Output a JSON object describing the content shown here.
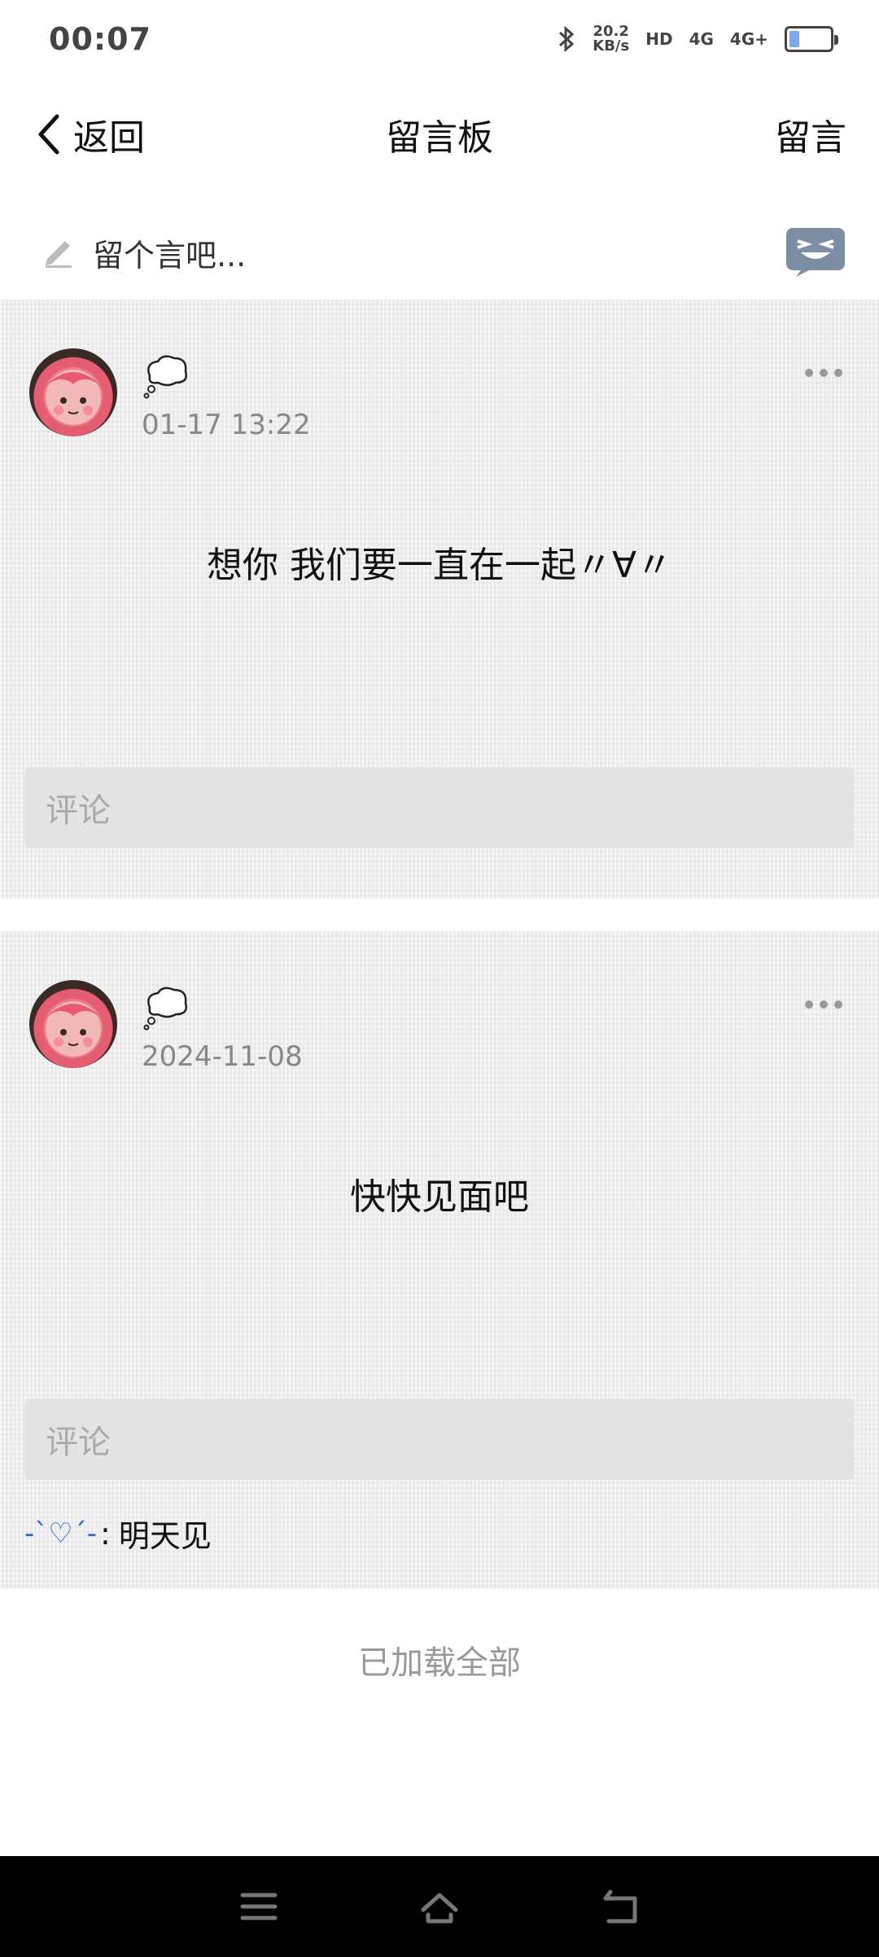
{
  "status": {
    "time": "00:07",
    "net_speed_value": "20.2",
    "net_speed_unit": "KB/s",
    "hd_tag": "HD",
    "sim1": "4G",
    "sim2": "4G+",
    "battery_level": 0.25,
    "icons": [
      "bluetooth-icon",
      "hd-icon",
      "signal-icon",
      "battery-icon"
    ]
  },
  "nav": {
    "back_label": "返回",
    "title": "留言板",
    "action_label": "留言"
  },
  "compose": {
    "placeholder": "留个言吧..."
  },
  "posts": [
    {
      "time": "01-17 13:22",
      "message": "想你 我们要一直在一起〃∀〃",
      "comment_placeholder": "评论"
    },
    {
      "time": "2024-11-08",
      "message": "快快见面吧",
      "comment_placeholder": "评论",
      "reply": {
        "name": "-ˋ♡ˊ-",
        "text": "明天见"
      }
    }
  ],
  "footer": {
    "loaded_text": "已加载全部"
  },
  "colors": {
    "card_bg": "#efefef",
    "accent_blue": "#2e6ad0",
    "muted_text": "#888888"
  }
}
